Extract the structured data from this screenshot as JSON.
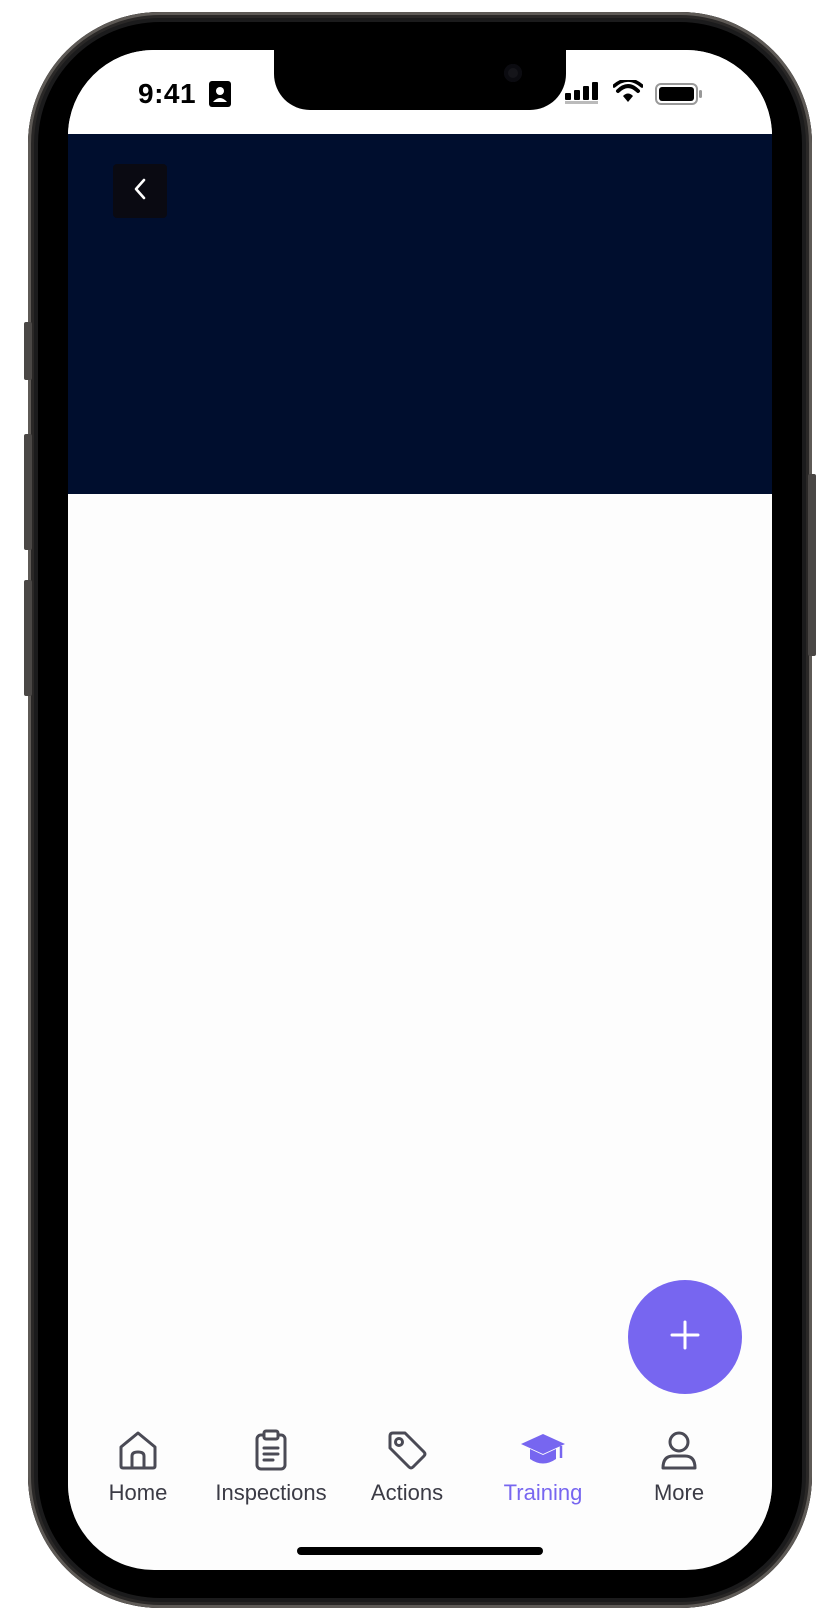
{
  "status_bar": {
    "time": "9:41"
  },
  "colors": {
    "header_bg": "#000e2e",
    "accent": "#7766f0",
    "tab_inactive": "#3b3b45",
    "screen_bg": "#fdfdfd"
  },
  "icons": {
    "back": "chevron-left-icon",
    "fab": "plus-icon"
  },
  "tabs": [
    {
      "label": "Home",
      "icon": "home-icon",
      "active": false
    },
    {
      "label": "Inspections",
      "icon": "clipboard-icon",
      "active": false
    },
    {
      "label": "Actions",
      "icon": "tag-icon",
      "active": false
    },
    {
      "label": "Training",
      "icon": "graduation-cap-icon",
      "active": true
    },
    {
      "label": "More",
      "icon": "person-icon",
      "active": false
    }
  ]
}
